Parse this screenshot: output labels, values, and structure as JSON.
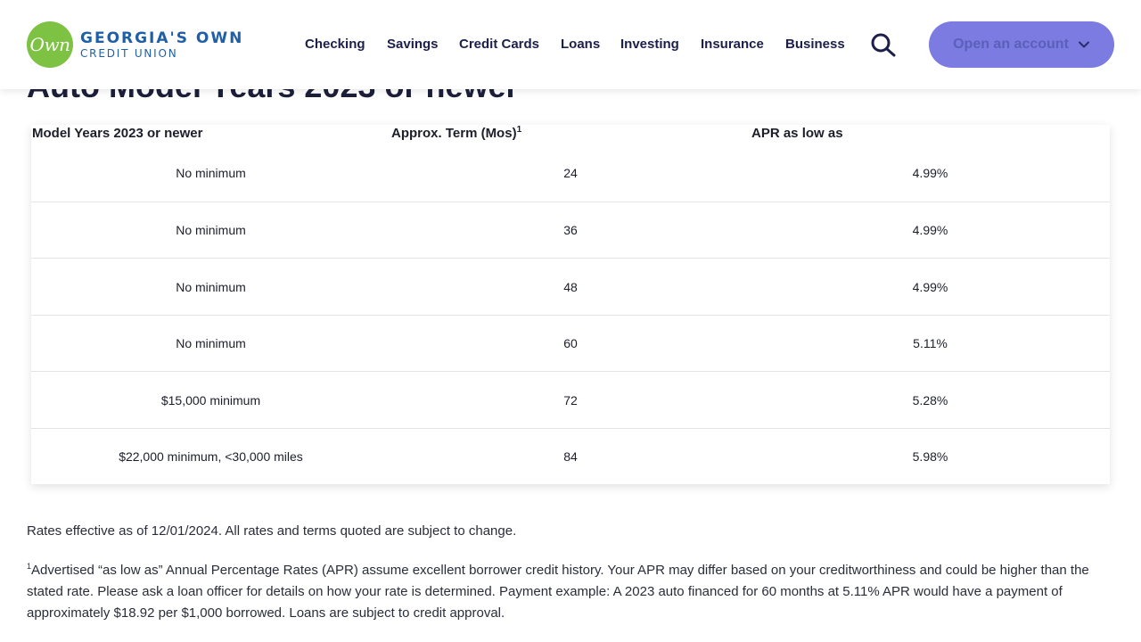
{
  "header": {
    "logo": {
      "mark": "Own",
      "line1": "GEORGIA'S OWN",
      "line2": "CREDIT UNION"
    },
    "nav": [
      "Checking",
      "Savings",
      "Credit Cards",
      "Loans",
      "Investing",
      "Insurance",
      "Business"
    ],
    "search_icon": "search-icon",
    "cta_label": "Open an account",
    "colors": {
      "brand_green": "#7dc242",
      "brand_blue": "#1f5fa8",
      "cta": "#7b7be2"
    }
  },
  "section": {
    "title": "Auto Model Years 2023 or newer"
  },
  "table": {
    "headers": [
      "Model Years 2023 or newer",
      "Approx. Term (Mos)",
      "APR as low as"
    ],
    "term_superscript": "1",
    "rows": [
      [
        "No minimum",
        "24",
        "4.99%"
      ],
      [
        "No minimum",
        "36",
        "4.99%"
      ],
      [
        "No minimum",
        "48",
        "4.99%"
      ],
      [
        "No minimum",
        "60",
        "5.11%"
      ],
      [
        "$15,000 minimum",
        "72",
        "5.28%"
      ],
      [
        "$22,000 minimum, <30,000 miles",
        "84",
        "5.98%"
      ]
    ]
  },
  "notes": {
    "effective": "Rates effective as of 12/01/2024. All rates and terms quoted are subject to change.",
    "footnote_marker": "1",
    "footnote": "Advertised “as low as” Annual Percentage Rates (APR) assume excellent borrower credit history. Your APR may differ based on your creditworthiness and could be higher than the stated rate. Please ask a loan officer for details on how your rate is determined. Payment example: A 2023 auto financed for 60 months at 5.11% APR would have a payment of approximately $18.92 per $1,000 borrowed. Loans are subject to credit approval."
  }
}
